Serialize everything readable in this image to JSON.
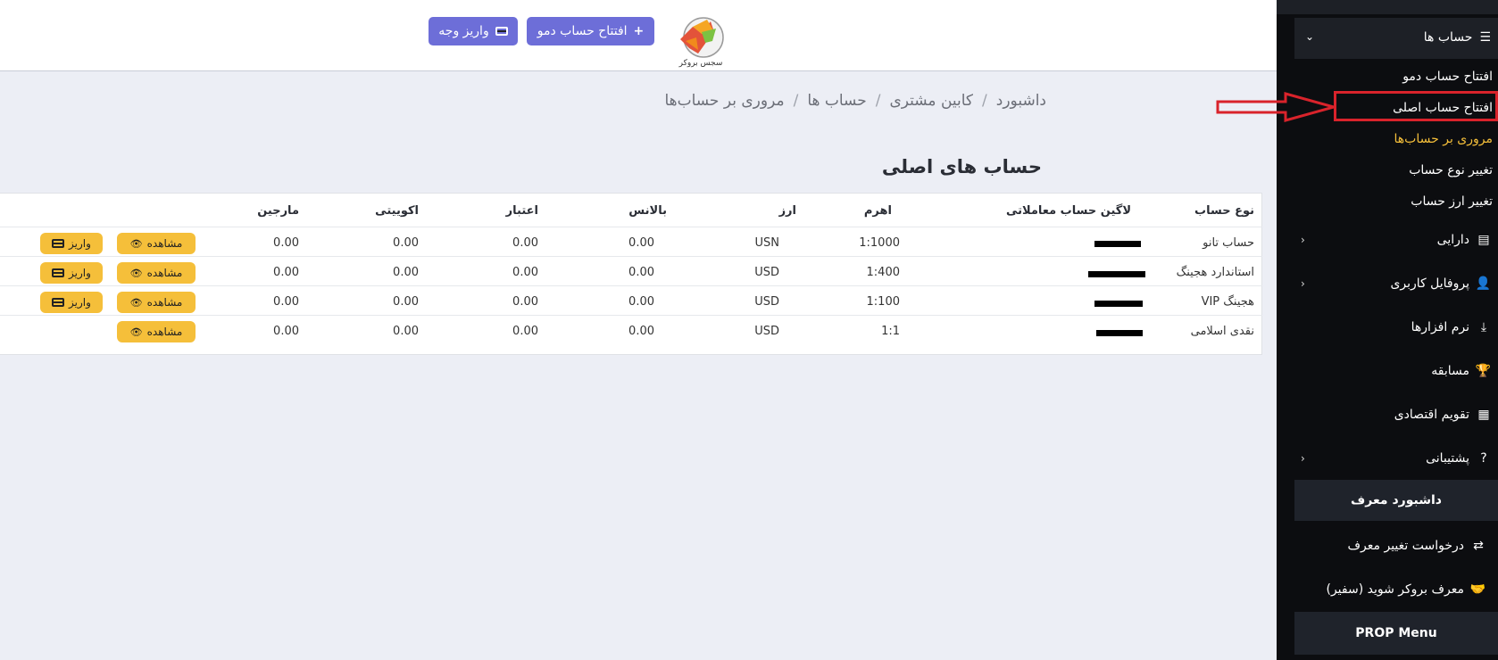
{
  "topbar": {
    "demo_button": "افتتاح حساب دمو",
    "deposit_button": "واریز وجه",
    "logo_text": "سجس بروکر"
  },
  "breadcrumb": {
    "items": [
      "داشبورد",
      "کابین مشتری",
      "حساب ها",
      "مروری بر حساب‌ها"
    ]
  },
  "page": {
    "title": "حساب های اصلی"
  },
  "table": {
    "headers": {
      "type": "نوع حساب",
      "login": "لاگین حساب معاملاتی",
      "leverage": "اهرم",
      "currency": "ارز",
      "balance": "بالانس",
      "credit": "اعتبار",
      "equity": "اکوییتی",
      "margin": "مارجین"
    },
    "rows": [
      {
        "type": "حساب تانو",
        "leverage": "1:1000",
        "currency": "USN",
        "balance": "0.00",
        "credit": "0.00",
        "equity": "0.00",
        "margin": "0.00",
        "view": "مشاهده",
        "deposit": "واریز"
      },
      {
        "type": "استاندارد هجینگ",
        "leverage": "1:400",
        "currency": "USD",
        "balance": "0.00",
        "credit": "0.00",
        "equity": "0.00",
        "margin": "0.00",
        "view": "مشاهده",
        "deposit": "واریز"
      },
      {
        "type": "VIP هجینگ",
        "leverage": "1:100",
        "currency": "USD",
        "balance": "0.00",
        "credit": "0.00",
        "equity": "0.00",
        "margin": "0.00",
        "view": "مشاهده",
        "deposit": "واریز"
      },
      {
        "type": "نقدی اسلامی",
        "leverage": "1:1",
        "currency": "USD",
        "balance": "0.00",
        "credit": "0.00",
        "equity": "0.00",
        "margin": "0.00",
        "view": "مشاهده"
      }
    ]
  },
  "sidebar": {
    "accounts": "حساب ها",
    "sub": [
      "افتتاح حساب دمو",
      "افتتاح حساب اصلی",
      "مروری بر حساب‌ها",
      "تغییر نوع حساب",
      "تغییر ارز حساب"
    ],
    "items": [
      "دارایی",
      "پروفایل کاربری",
      "نرم افزارها",
      "مسابقه",
      "تقویم اقتصادی",
      "پشتیبانی"
    ],
    "referrer_dashboard": "داشبورد معرف",
    "ref_change": "درخواست تغییر معرف",
    "ref_become": "معرف بروکر شوید (سفیر)",
    "prop_menu": "PROP Menu"
  },
  "colors": {
    "accent": "#6d6ed8",
    "action": "#f5bf3a",
    "active_link": "#f5bf3a",
    "annotation": "#d9232b"
  }
}
